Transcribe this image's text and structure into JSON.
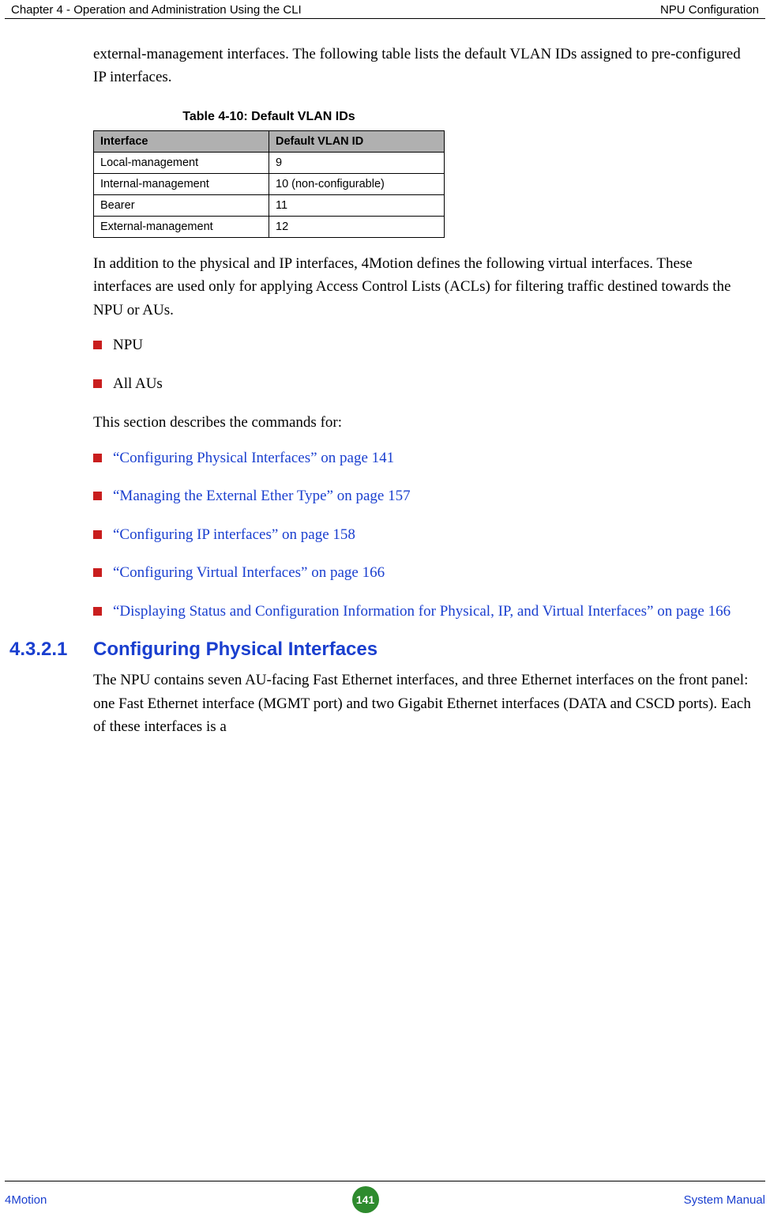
{
  "header": {
    "left": "Chapter 4 - Operation and Administration Using the CLI",
    "right": "NPU Configuration"
  },
  "intro_para": "external-management interfaces. The following table lists the default VLAN IDs assigned to pre-configured IP interfaces.",
  "table": {
    "caption": "Table 4-10: Default VLAN IDs",
    "head": {
      "c1": "Interface",
      "c2": "Default VLAN ID"
    },
    "rows": [
      {
        "c1": "Local-management",
        "c2": "9"
      },
      {
        "c1": "Internal-management",
        "c2": "10 (non-configurable)"
      },
      {
        "c1": "Bearer",
        "c2": "11"
      },
      {
        "c1": "External-management",
        "c2": "12"
      }
    ]
  },
  "after_table_para": "In addition to the physical and IP interfaces, 4Motion defines the following virtual interfaces. These interfaces are used only for applying Access Control Lists (ACLs) for filtering traffic destined towards the NPU or AUs.",
  "plain_bullets": [
    "NPU",
    "All AUs"
  ],
  "commands_para": "This section describes the commands for:",
  "link_bullets": [
    "“Configuring Physical Interfaces” on page 141",
    "“Managing the External Ether Type” on page 157",
    "“Configuring IP interfaces” on page 158",
    "“Configuring Virtual Interfaces” on page 166",
    "“Displaying Status and Configuration Information for Physical, IP, and Virtual Interfaces” on page 166"
  ],
  "section": {
    "number": "4.3.2.1",
    "title": "Configuring Physical Interfaces",
    "body": "The NPU contains seven AU-facing Fast Ethernet interfaces, and three Ethernet interfaces on the front panel: one Fast Ethernet interface (MGMT port) and two Gigabit Ethernet interfaces (DATA and CSCD ports). Each of these interfaces is a"
  },
  "footer": {
    "left": "4Motion",
    "page": "141",
    "right": "System Manual"
  }
}
